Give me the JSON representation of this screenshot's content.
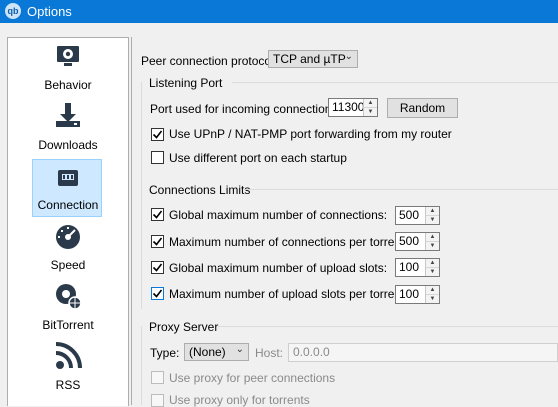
{
  "window": {
    "title": "Options",
    "app_icon_text": "qb"
  },
  "sidebar": {
    "items": [
      {
        "label": "Behavior",
        "icon": "gear-monitor-icon"
      },
      {
        "label": "Downloads",
        "icon": "download-icon"
      },
      {
        "label": "Connection",
        "icon": "network-icon",
        "selected": true
      },
      {
        "label": "Speed",
        "icon": "speedometer-icon"
      },
      {
        "label": "BitTorrent",
        "icon": "gear-globe-icon"
      },
      {
        "label": "RSS",
        "icon": "rss-icon"
      }
    ]
  },
  "connection": {
    "protocol_label": "Peer connection protocol:",
    "protocol_value": "TCP and µTP",
    "listening": {
      "title": "Listening Port",
      "port_label": "Port used for incoming connections:",
      "port_value": "11300",
      "random_label": "Random",
      "upnp_label": "Use UPnP / NAT-PMP port forwarding from my router",
      "upnp_checked": true,
      "diff_port_label": "Use different port on each startup",
      "diff_port_checked": false
    },
    "limits": {
      "title": "Connections Limits",
      "rows": [
        {
          "label": "Global maximum number of connections:",
          "value": "500",
          "checked": true
        },
        {
          "label": "Maximum number of connections per torrent:",
          "value": "500",
          "checked": true
        },
        {
          "label": "Global maximum number of upload slots:",
          "value": "100",
          "checked": true
        },
        {
          "label": "Maximum number of upload slots per torrent:",
          "value": "100",
          "checked": true
        }
      ]
    },
    "proxy": {
      "title": "Proxy Server",
      "type_label": "Type:",
      "type_value": "(None)",
      "host_label": "Host:",
      "host_placeholder": "0.0.0.0",
      "peer_label": "Use proxy for peer connections",
      "torrents_only_label": "Use proxy only for torrents"
    }
  },
  "colors": {
    "titlebar": "#0a78d7",
    "selection": "#cde8ff",
    "icon": "#2b3a4a"
  }
}
